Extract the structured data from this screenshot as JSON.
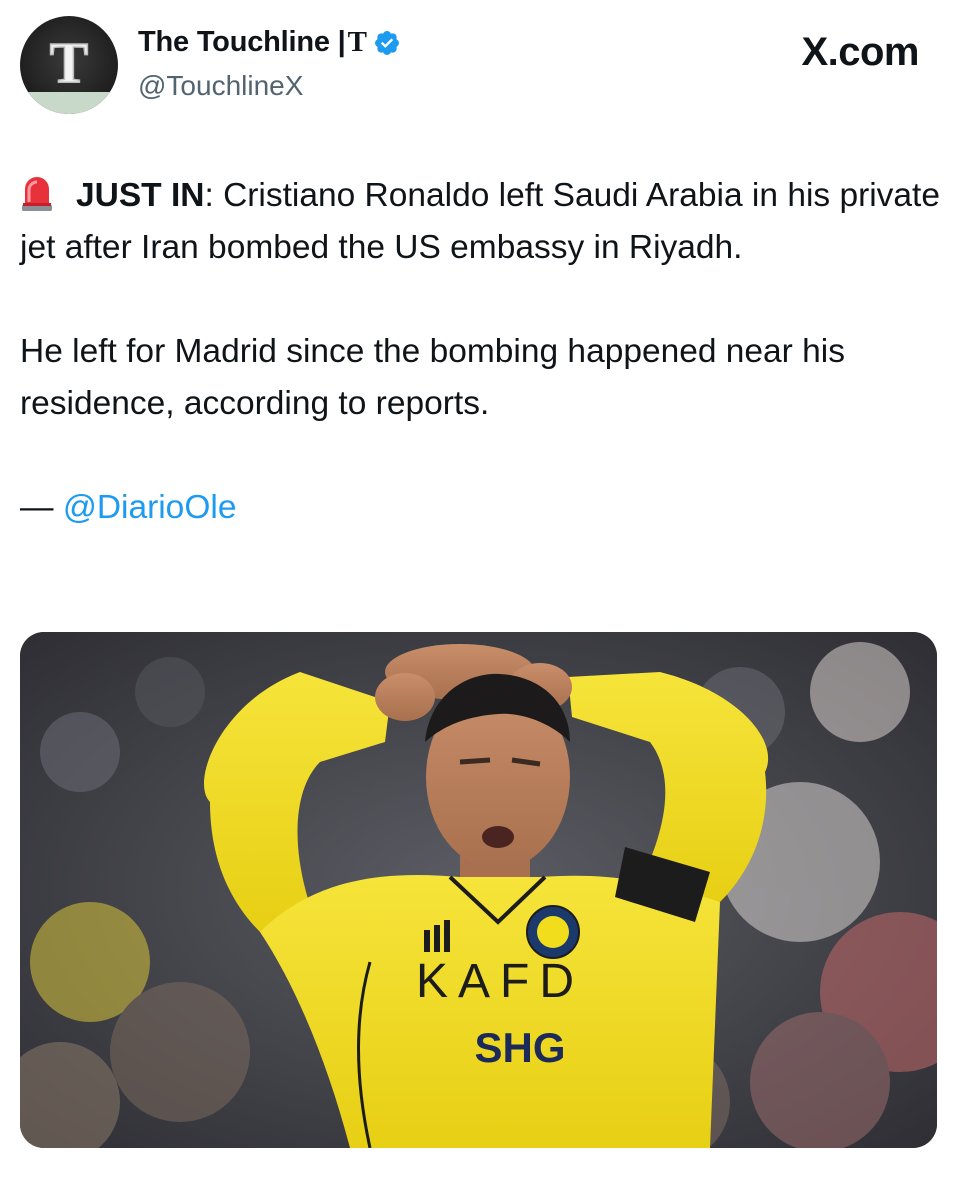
{
  "author": {
    "display_name": "The Touchline |",
    "name_suffix": "T",
    "handle": "@TouchlineX",
    "avatar_letter": "T"
  },
  "source_site": "X.com",
  "tweet": {
    "emoji": "🚨",
    "lead_bold": "JUST IN",
    "lead_rest": ": Cristiano Ronaldo left Saudi Arabia in his private jet after Iran bombed the US embassy in Riyadh.",
    "paragraph2": "He left for Madrid since the bombing happened near his residence, according to reports.",
    "attribution_dash": "— ",
    "attribution_mention": "@DiarioOle"
  },
  "photo": {
    "shirt_sponsor": "KAFD",
    "sleeve_sponsor": "SHG",
    "colors": {
      "shirt": "#f2dd1c",
      "background": "#4a4a52"
    }
  },
  "colors": {
    "link": "#1d9bf0",
    "verified": "#1d9bf0",
    "text": "#0f1419",
    "secondary": "#536471"
  }
}
